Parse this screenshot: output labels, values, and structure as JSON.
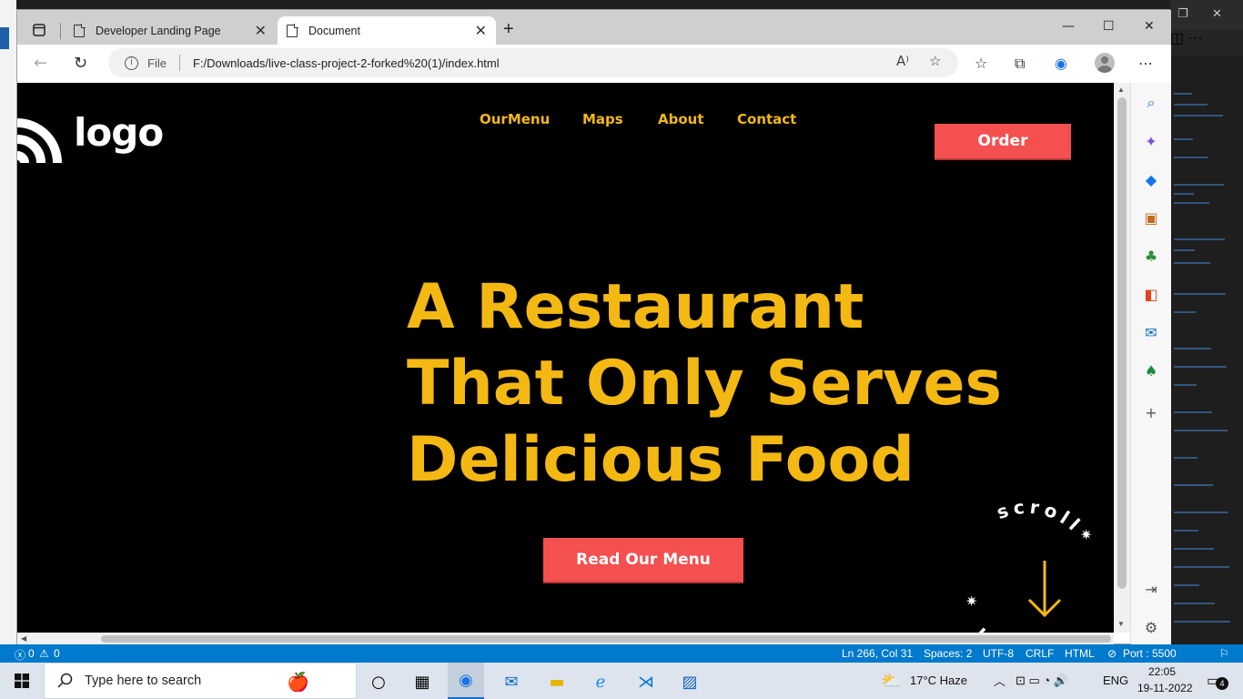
{
  "browser": {
    "tabs": [
      {
        "title": "Developer Landing Page",
        "active": false
      },
      {
        "title": "Document",
        "active": true
      }
    ],
    "address": {
      "scheme_label": "File",
      "url": "F:/Downloads/live-class-project-2-forked%20(1)/index.html"
    }
  },
  "site": {
    "logo_text": "logo",
    "nav_links": [
      "OurMenu",
      "Maps",
      "About",
      "Contact"
    ],
    "order_label": "Order",
    "hero_lines": [
      "A Restaurant",
      "That Only Serves",
      "Delicious Food"
    ],
    "cta_label": "Read Our Menu",
    "scroll_badge_text": "scroll",
    "colors": {
      "accent": "#f4b813",
      "button": "#f45050",
      "background": "#000000"
    }
  },
  "statusbar": {
    "problems": "0",
    "warnings": "0",
    "position": "Ln 266, Col 31",
    "spaces": "Spaces: 2",
    "encoding": "UTF-8",
    "eol": "CRLF",
    "language": "HTML",
    "port": "Port : 5500"
  },
  "taskbar": {
    "search_placeholder": "Type here to search",
    "weather": "17°C  Haze",
    "language": "ENG",
    "time": "22:05",
    "date": "19-11-2022",
    "notification_count": "4"
  }
}
